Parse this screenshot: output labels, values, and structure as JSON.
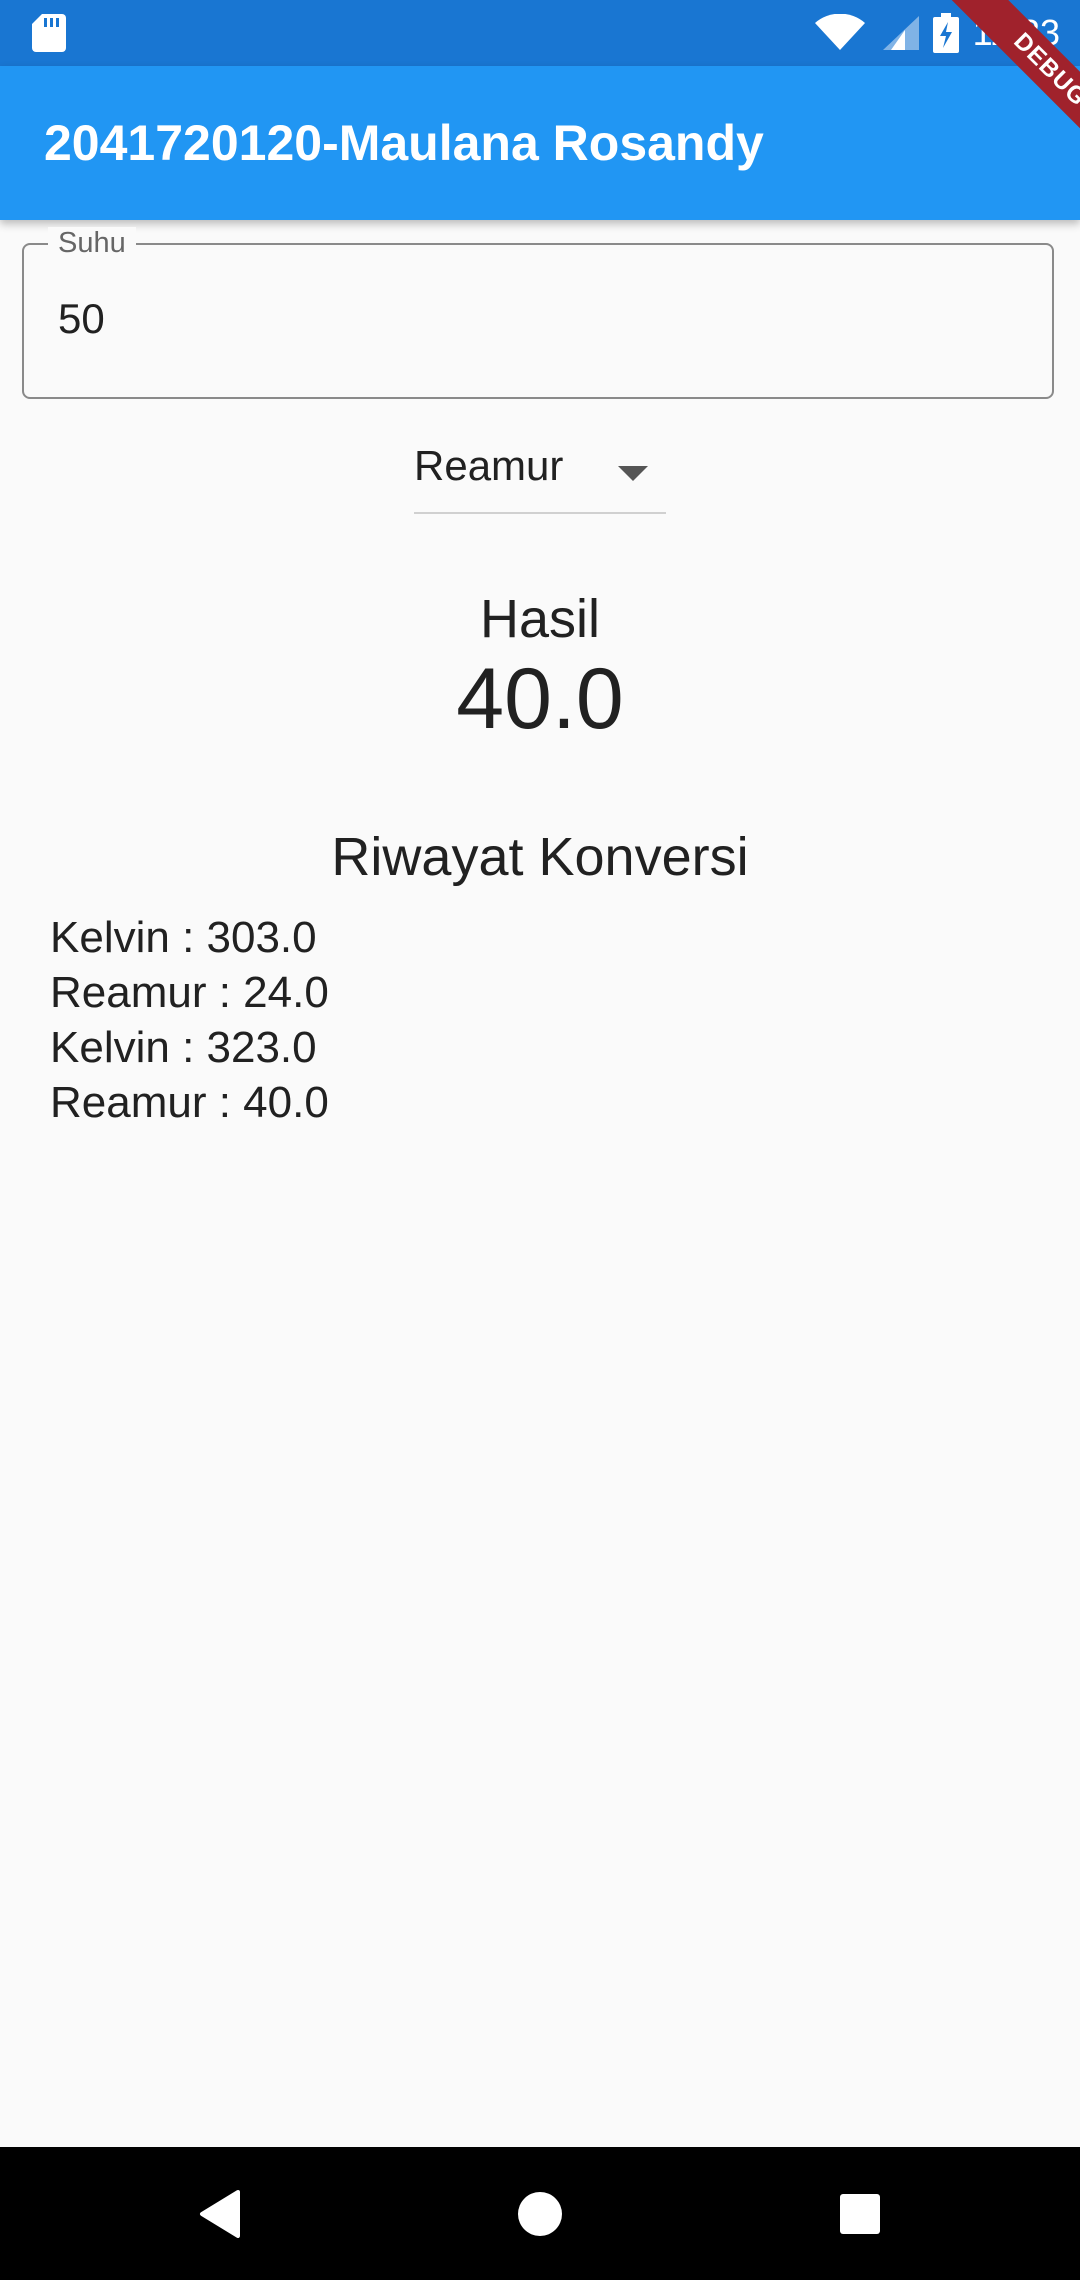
{
  "status_bar": {
    "time": "11:33",
    "icons": [
      "sd-card-icon",
      "wifi-icon",
      "signal-icon",
      "battery-charging-icon"
    ],
    "background": "#1976d2"
  },
  "debug_banner": {
    "label": "DEBUG",
    "color": "#a0222c"
  },
  "app_bar": {
    "title": "2041720120-Maulana Rosandy",
    "background": "#2196f3"
  },
  "temperature_input": {
    "label": "Suhu",
    "value": "50"
  },
  "unit_dropdown": {
    "selected": "Reamur"
  },
  "result": {
    "label": "Hasil",
    "value": "40.0"
  },
  "history": {
    "title": "Riwayat Konversi",
    "items": [
      "Kelvin : 303.0",
      "Reamur : 24.0",
      "Kelvin : 323.0",
      "Reamur : 40.0"
    ]
  },
  "nav_bar": {
    "buttons": [
      "back-icon",
      "home-icon",
      "recents-icon"
    ]
  }
}
